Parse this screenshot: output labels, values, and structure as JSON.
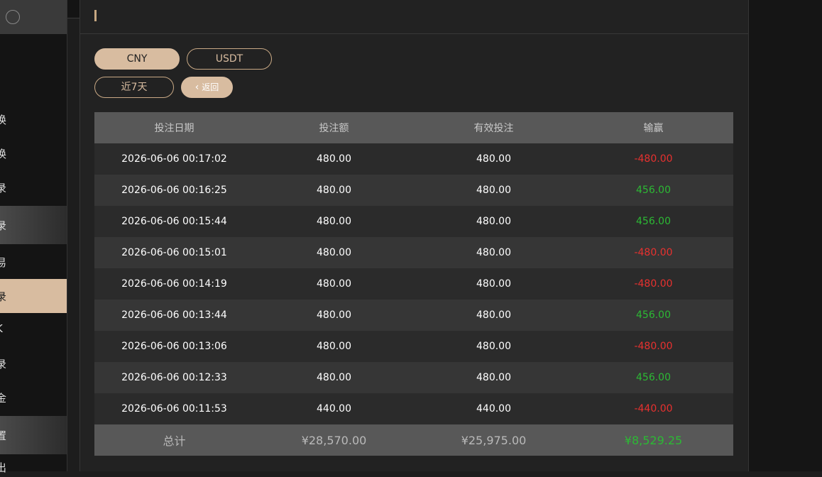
{
  "sidebar": {
    "items": [
      {
        "label": "换"
      },
      {
        "label": "换"
      },
      {
        "label": "录"
      },
      {
        "label": "录"
      },
      {
        "label": "易"
      },
      {
        "label": "录"
      },
      {
        "label": "K"
      },
      {
        "label": "录"
      },
      {
        "label": "金"
      },
      {
        "label": "置"
      },
      {
        "label": "出"
      }
    ]
  },
  "currency_tabs": {
    "cny": "CNY",
    "usdt": "USDT"
  },
  "filters": {
    "range": "近7天",
    "back": "返回"
  },
  "table": {
    "headers": [
      "投注日期",
      "投注额",
      "有效投注",
      "输赢"
    ],
    "rows": [
      {
        "date": "2026-06-06 00:17:02",
        "bet": "480.00",
        "valid": "480.00",
        "result": "-480.00"
      },
      {
        "date": "2026-06-06 00:16:25",
        "bet": "480.00",
        "valid": "480.00",
        "result": "456.00"
      },
      {
        "date": "2026-06-06 00:15:44",
        "bet": "480.00",
        "valid": "480.00",
        "result": "456.00"
      },
      {
        "date": "2026-06-06 00:15:01",
        "bet": "480.00",
        "valid": "480.00",
        "result": "-480.00"
      },
      {
        "date": "2026-06-06 00:14:19",
        "bet": "480.00",
        "valid": "480.00",
        "result": "-480.00"
      },
      {
        "date": "2026-06-06 00:13:44",
        "bet": "480.00",
        "valid": "480.00",
        "result": "456.00"
      },
      {
        "date": "2026-06-06 00:13:06",
        "bet": "480.00",
        "valid": "480.00",
        "result": "-480.00"
      },
      {
        "date": "2026-06-06 00:12:33",
        "bet": "480.00",
        "valid": "480.00",
        "result": "456.00"
      },
      {
        "date": "2026-06-06 00:11:53",
        "bet": "440.00",
        "valid": "440.00",
        "result": "-440.00"
      }
    ],
    "total": {
      "label": "总计",
      "bet": "¥28,570.00",
      "valid": "¥25,975.00",
      "result": "¥8,529.25"
    }
  },
  "colors": {
    "accent": "#d8bca0",
    "loss": "#e8312f",
    "win": "#2cb934"
  }
}
